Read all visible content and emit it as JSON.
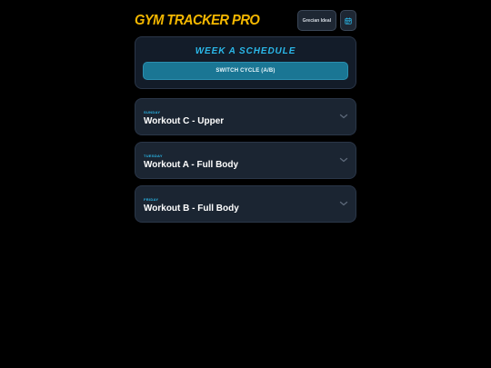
{
  "header": {
    "title": "GYM TRACKER PRO",
    "user_label": "Grecian Ideal",
    "calendar_icon": "calendar-icon"
  },
  "schedule": {
    "title": "WEEK A SCHEDULE",
    "switch_label": "SWITCH CYCLE (A/B)"
  },
  "workouts": [
    {
      "day": "SUNDAY",
      "name": "Workout C - Upper"
    },
    {
      "day": "TUESDAY",
      "name": "Workout A - Full Body"
    },
    {
      "day": "FRIDAY",
      "name": "Workout B - Full Body"
    }
  ],
  "colors": {
    "accent_yellow": "#f5b800",
    "accent_cyan": "#2ab7e8",
    "button_teal": "#1a7694",
    "background": "#000000",
    "card": "#1b2532"
  }
}
